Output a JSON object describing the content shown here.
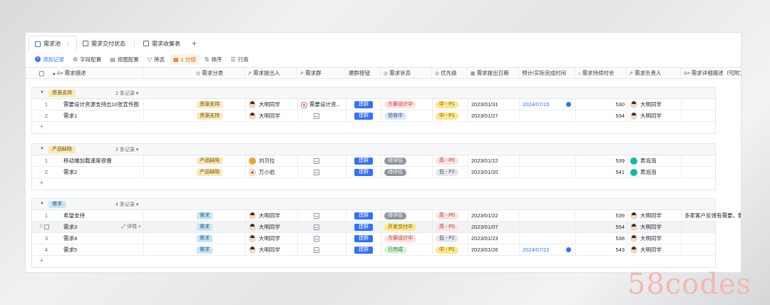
{
  "tabs": [
    {
      "label": "需求池",
      "more": "⋮",
      "active": true
    },
    {
      "label": "需求交付状态",
      "active": false
    },
    {
      "label": "需求收集表",
      "active": false
    }
  ],
  "tab_add": "+",
  "toolbar": {
    "add_record": "添加记录",
    "field_config": "字段配置",
    "view_config": "视图配置",
    "filter": "筛选",
    "group": "1 分组",
    "sort": "排序",
    "row_height": "行高"
  },
  "columns": [
    "需求描述",
    "需求分类",
    "需求提出人",
    "需求群",
    "建群按钮",
    "需求状态",
    "优先级",
    "需求提出日期",
    "预计/实际完成时间",
    "需求持续时长",
    "需求负责人",
    "需求详细描述（可附文档）"
  ],
  "groups": [
    {
      "name": "资源支持",
      "count": "2 条记录 ▾",
      "tag_bg": "#fbe9b7",
      "tag_fg": "#6b4e00",
      "rows": [
        {
          "no": "1",
          "desc": "需要设计资源支持出10张宣传图",
          "category": "资源支持",
          "proposer": "大明同学",
          "avatar": "man",
          "chat": "需要设计资...",
          "has_chat": true,
          "button": "建群",
          "status": "方案设计中",
          "status_bg": "#fde2e2",
          "status_fg": "#c0392b",
          "priority": "中 - P1",
          "pri_bg": "#fde68a",
          "pri_fg": "#7a5b00",
          "date": "2023/01/31",
          "done": "2024/07/15",
          "duration": "530",
          "owner": "大明同学",
          "owner_av": "man",
          "detail": ""
        },
        {
          "no": "2",
          "desc": "需求1",
          "category": "资源支持",
          "proposer": "大明同学",
          "avatar": "man",
          "chat": "",
          "has_chat": false,
          "button": "建群",
          "status": "验收中",
          "status_bg": "#dbe4f7",
          "status_fg": "#2b4a8b",
          "priority": "中 - P1",
          "pri_bg": "#fde68a",
          "pri_fg": "#7a5b00",
          "date": "2023/01/27",
          "done": "",
          "duration": "534",
          "owner": "大明同学",
          "owner_av": "man",
          "detail": ""
        }
      ]
    },
    {
      "name": "产品缺陷",
      "count": "2 条记录 ▾",
      "tag_bg": "#fbe9b7",
      "tag_fg": "#6b4e00",
      "rows": [
        {
          "no": "1",
          "desc": "移动端加载速度很慢",
          "category": "产品缺陷",
          "proposer": "刘贝拉",
          "avatar": "liu",
          "chat": "",
          "has_chat": false,
          "button": "建群",
          "status": "待评估",
          "status_bg": "#8f959e",
          "status_fg": "#ffffff",
          "priority": "高 - P0",
          "pri_bg": "#fde2e2",
          "pri_fg": "#a33a3a",
          "date": "2023/01/22",
          "done": "",
          "duration": "539",
          "owner": "黄泡泡",
          "owner_av": "hua",
          "detail": ""
        },
        {
          "no": "2",
          "desc": "需求2",
          "category": "产品缺陷",
          "proposer": "万小岩",
          "avatar": "wan",
          "chat": "",
          "has_chat": false,
          "button": "建群",
          "status": "待评估",
          "status_bg": "#8f959e",
          "status_fg": "#ffffff",
          "priority": "低 - P2",
          "pri_bg": "#e5e7eb",
          "pri_fg": "#4b5563",
          "date": "2023/01/20",
          "done": "",
          "duration": "541",
          "owner": "黄泡泡",
          "owner_av": "hua",
          "detail": ""
        }
      ]
    },
    {
      "name": "需求",
      "count": "4 条记录 ▾",
      "tag_bg": "#c8e6f5",
      "tag_fg": "#1f5d7a",
      "rows": [
        {
          "no": "1",
          "desc": "希望支持",
          "category": "需求",
          "proposer": "大明同学",
          "avatar": "man",
          "chat": "",
          "has_chat": false,
          "button": "建群",
          "status": "待评估",
          "status_bg": "#8f959e",
          "status_fg": "#ffffff",
          "priority": "高 - P0",
          "pri_bg": "#fde2e2",
          "pri_fg": "#a33a3a",
          "date": "2023/01/22",
          "done": "",
          "duration": "539",
          "owner": "大明同学",
          "owner_av": "man",
          "detail": "多家客户反馈有需要，影响销售"
        },
        {
          "no": "",
          "desc": "需求3",
          "category": "需求",
          "proposer": "大明同学",
          "avatar": "man",
          "chat": "",
          "has_chat": false,
          "button": "建群",
          "status": "开发交付中",
          "status_bg": "#fde68a",
          "status_fg": "#7a5b00",
          "priority": "高 - P0",
          "pri_bg": "#fde2e2",
          "pri_fg": "#a33a3a",
          "date": "2023/01/07",
          "done": "",
          "duration": "554",
          "owner": "大明同学",
          "owner_av": "man",
          "detail": "",
          "hover": true,
          "detail_label": "详情"
        },
        {
          "no": "3",
          "desc": "需求4",
          "category": "需求",
          "proposer": "大明同学",
          "avatar": "man",
          "chat": "",
          "has_chat": false,
          "button": "建群",
          "status": "方案设计中",
          "status_bg": "#fde2e2",
          "status_fg": "#c0392b",
          "priority": "低 - P2",
          "pri_bg": "#e5e7eb",
          "pri_fg": "#4b5563",
          "date": "2023/01/23",
          "done": "",
          "duration": "538",
          "owner": "大明同学",
          "owner_av": "man",
          "detail": ""
        },
        {
          "no": "4",
          "desc": "需求5",
          "category": "需求",
          "proposer": "大明同学",
          "avatar": "man",
          "chat": "",
          "has_chat": false,
          "button": "建群",
          "status": "已完成",
          "status_bg": "#d4f3d8",
          "status_fg": "#237a35",
          "priority": "中 - P1",
          "pri_bg": "#fde68a",
          "pri_fg": "#7a5b00",
          "date": "2023/01/26",
          "done": "2024/07/22",
          "duration": "543",
          "owner": "大明同学",
          "owner_av": "man",
          "detail": ""
        }
      ]
    }
  ],
  "category_colors": {
    "资源支持": "#fbe9b7",
    "产品缺陷": "#fbe9b7",
    "需求": "#c8e6f5"
  },
  "watermark": "58codes"
}
